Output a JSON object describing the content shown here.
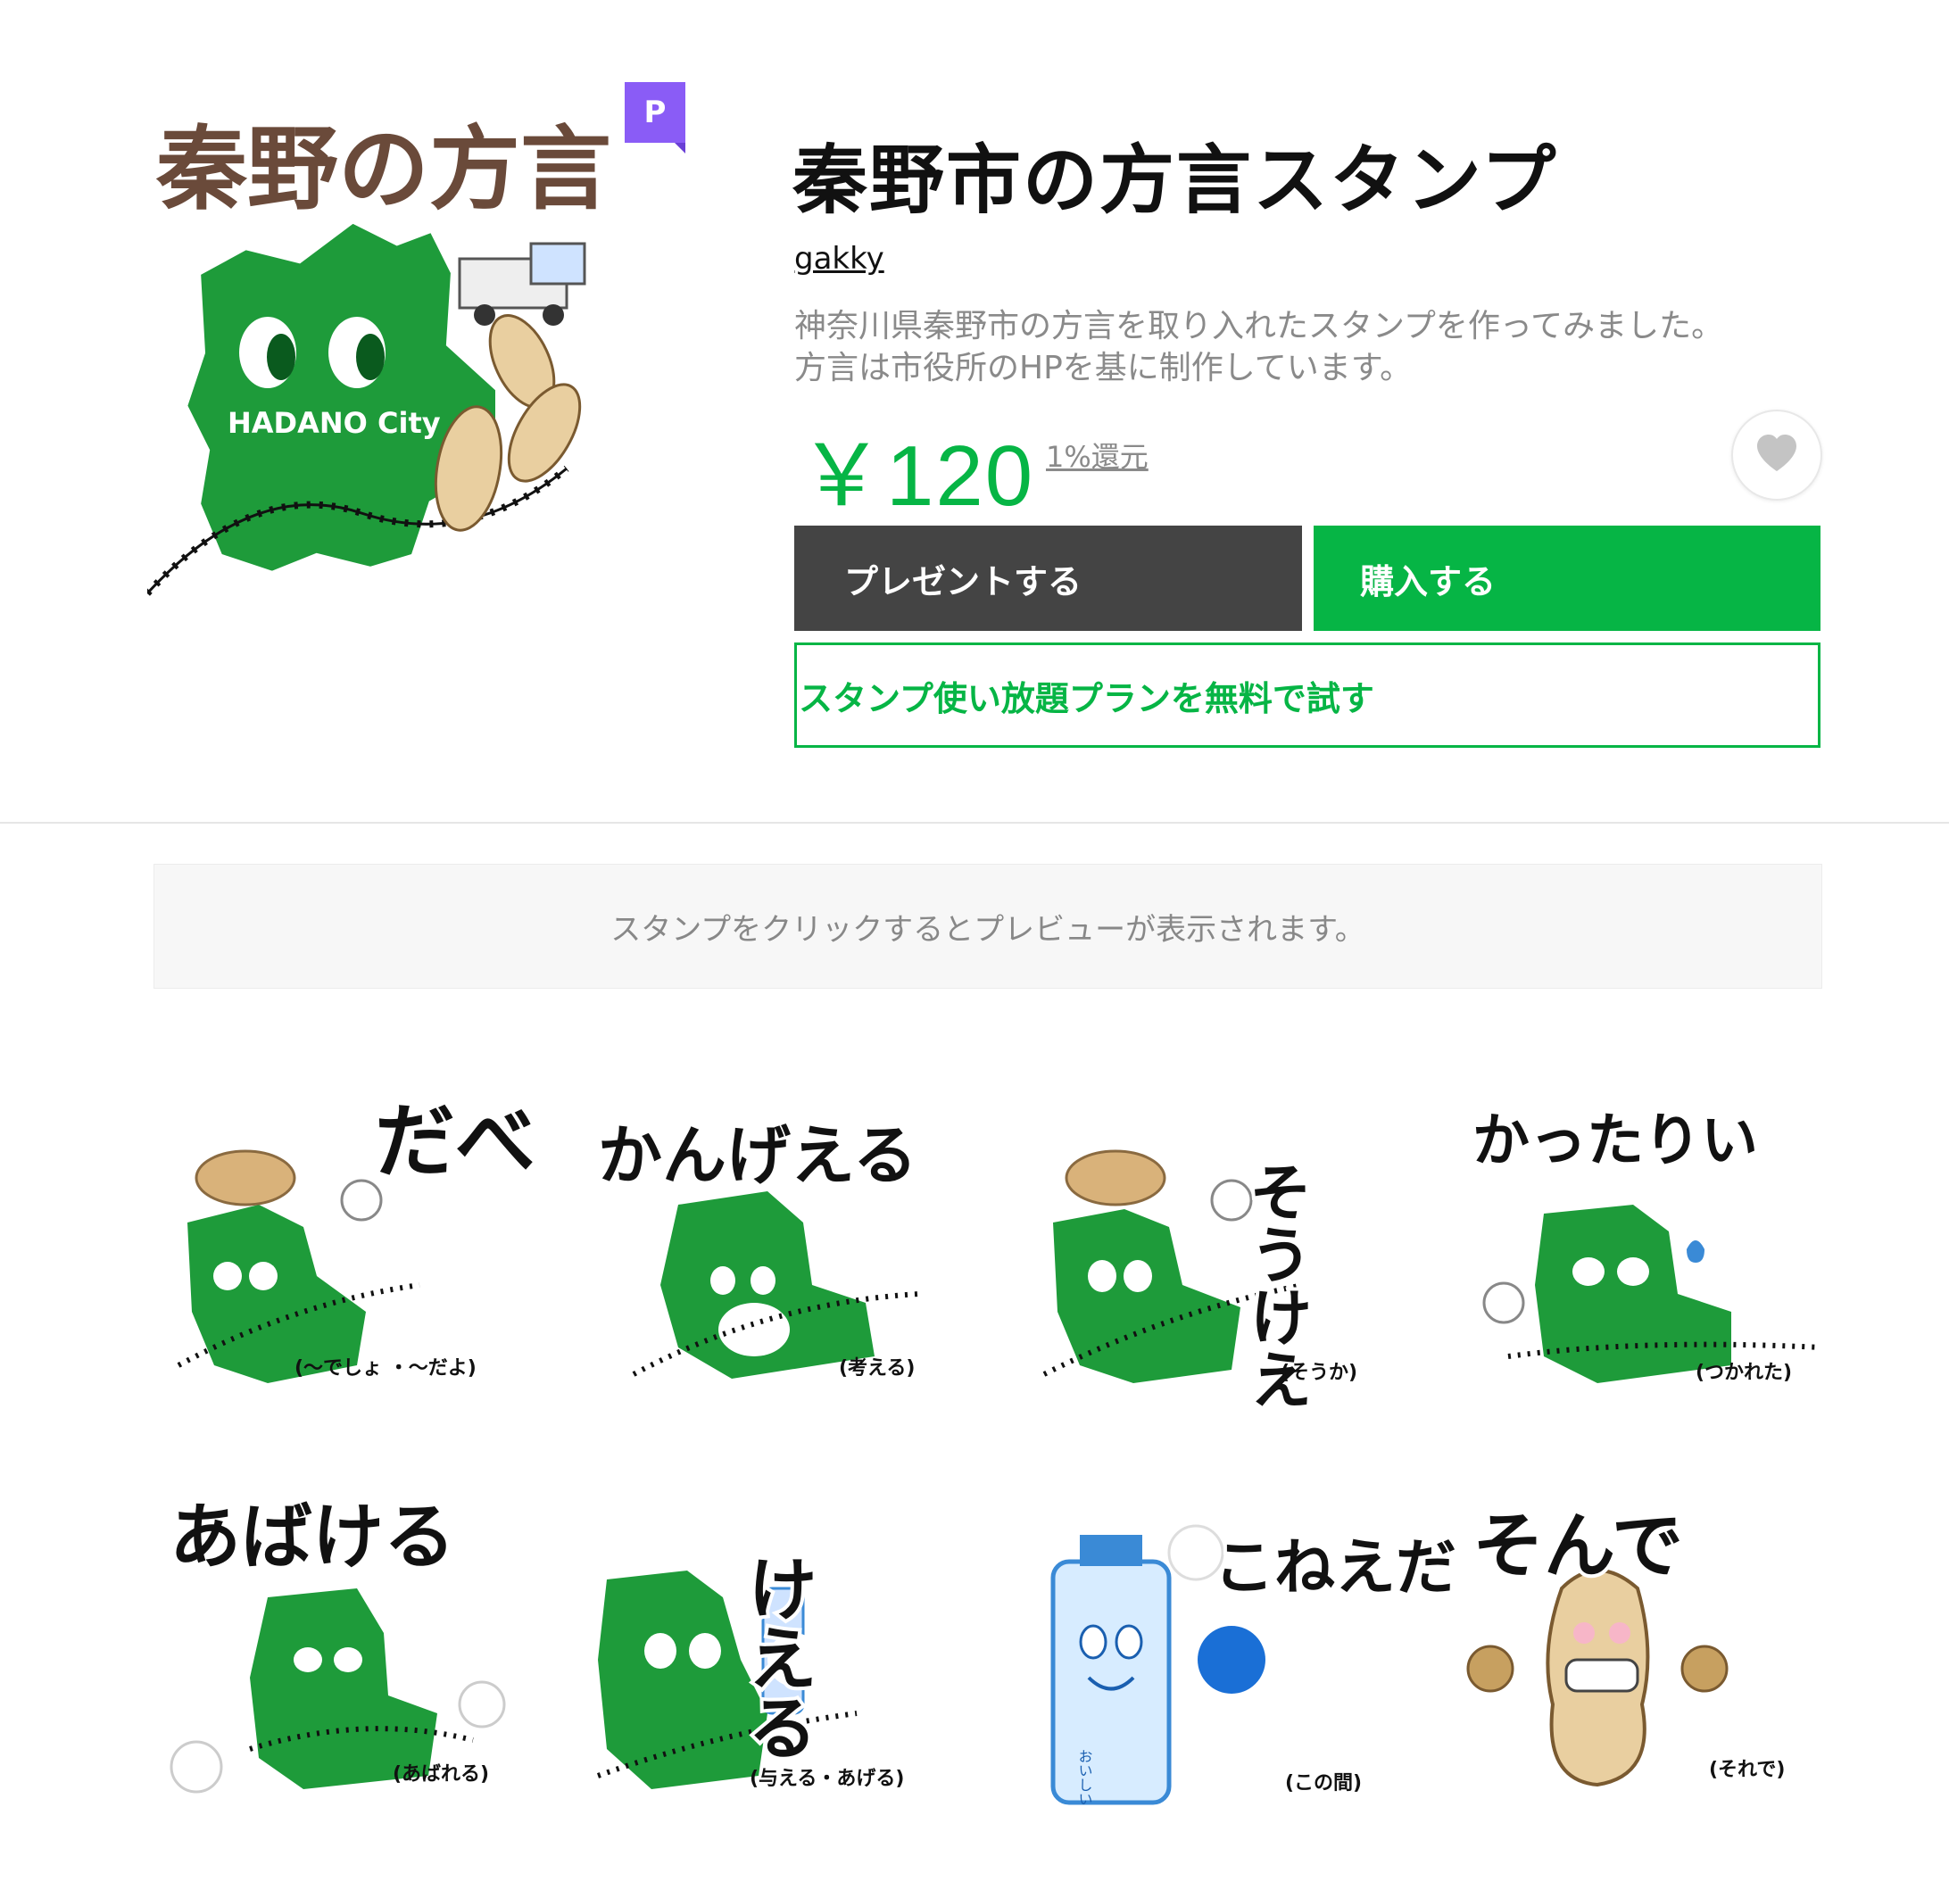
{
  "product": {
    "title": "秦野市の方言スタンプ",
    "author": "gakky",
    "description_line1": "神奈川県秦野市の方言を取り入れたスタンプを作ってみました。",
    "description_line2": "方言は市役所のHPを基に制作しています。",
    "price": "￥120",
    "cashback": "1%還元",
    "badge": "P",
    "main_image": {
      "title_text": "秦野の方言",
      "city_label": "HADANO City"
    }
  },
  "buttons": {
    "gift": "プレゼントする",
    "buy": "購入する",
    "plan": "スタンプ使い放題プランを無料で試す"
  },
  "preview_notice": "スタンプをクリックするとプレビューが表示されます。",
  "stickers": [
    {
      "text": "だべ",
      "caption": "(〜でしょ ・〜だよ)"
    },
    {
      "text": "かんげえる",
      "caption": "(考える)"
    },
    {
      "text": "そうけえ",
      "caption": "(そうか)"
    },
    {
      "text": "かったりい",
      "caption": "(つかれた)"
    },
    {
      "text": "あばける",
      "caption": "(あばれる)"
    },
    {
      "text": "けえる",
      "caption": "(与える・あげる)"
    },
    {
      "text": "こねえだ",
      "caption": "(この間)"
    },
    {
      "text": "そんで",
      "caption": "(それで)"
    }
  ],
  "bottle_label": "おいしい",
  "colors": {
    "accent_green": "#06b545",
    "gift_dark": "#444444",
    "premium_purple": "#8a5cf6",
    "map_green": "#1e9b3a"
  }
}
